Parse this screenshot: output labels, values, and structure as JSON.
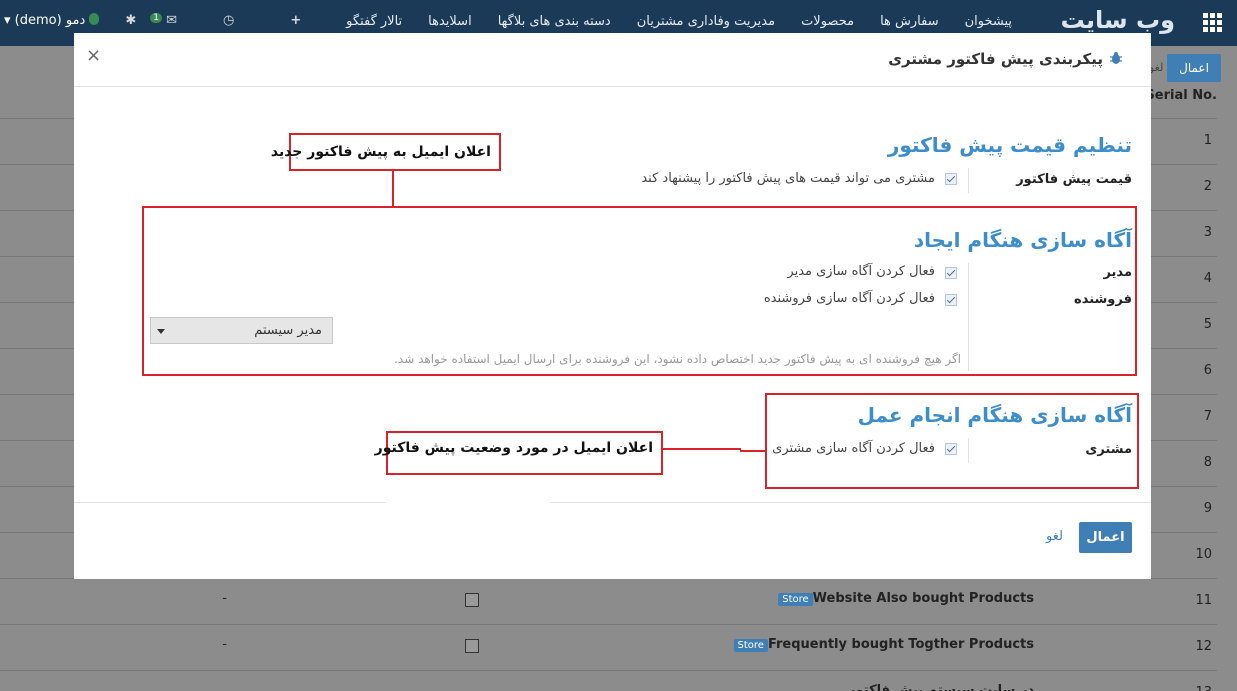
{
  "navbar": {
    "brand": "وب سایت",
    "menu": [
      "پیشخوان",
      "سفارش ها",
      "محصولات",
      "مدیریت وفاداری مشتریان",
      "دسته بندی های بلاگها",
      "اسلایدها",
      "تالار گفتگو"
    ],
    "user": "دمو (demo)",
    "chat_badge": "1"
  },
  "background": {
    "apply_label": "اعمال",
    "cancel_partial": "لغو",
    "serial_header": "Serial No.",
    "rows": [
      {
        "num": "1"
      },
      {
        "num": "2"
      },
      {
        "num": "3"
      },
      {
        "num": "4"
      },
      {
        "num": "5"
      },
      {
        "num": "6"
      },
      {
        "num": "7"
      },
      {
        "num": "8"
      },
      {
        "num": "9"
      },
      {
        "num": "10"
      },
      {
        "num": "11",
        "name": "Website Also bought Products",
        "badge": "Store",
        "dash": "-"
      },
      {
        "num": "12",
        "name": "Frequently bought Togther Products",
        "badge": "Store",
        "dash": "-"
      },
      {
        "num": "13",
        "name": "در سایت سیستم پیش فاکتور"
      }
    ]
  },
  "modal": {
    "title": "پیکربندی پیش فاکتور مشتری",
    "close": "×",
    "section1": {
      "heading": "تنظیم قیمت پیش فاکتور",
      "label": "قیمت پیش فاکتور",
      "option": "مشتری می تواند قیمت های پیش فاکتور را پیشنهاد کند"
    },
    "section2": {
      "heading": "آگاه سازی هنگام ایجاد",
      "label_manager": "مدیر",
      "label_seller": "فروشنده",
      "option_manager": "فعال کردن آگاه سازی مدیر",
      "option_seller": "فعال کردن آگاه سازی فروشنده",
      "select_value": "مدیر سیستم",
      "hint": "اگر هیچ فروشنده ای به پیش فاکتور جدید اختصاص داده نشود، این فروشنده برای ارسال ایمیل استفاده خواهد شد."
    },
    "section3": {
      "heading": "آگاه سازی هنگام انجام عمل",
      "label": "مشتری",
      "option": "فعال کردن آگاه سازی مشتری"
    },
    "apply": "اعمال",
    "cancel": "لغو"
  },
  "annotations": {
    "new_quote_email": "اعلان ایمیل به پیش فاکتور جدید",
    "status_email": "اعلان ایمیل در مورد وضعیت پیش فاکتور"
  },
  "colors": {
    "navbar": "#1b3a58",
    "accent": "#3c8dcc",
    "button": "#3f7fb6",
    "annotation": "#d9232b"
  }
}
